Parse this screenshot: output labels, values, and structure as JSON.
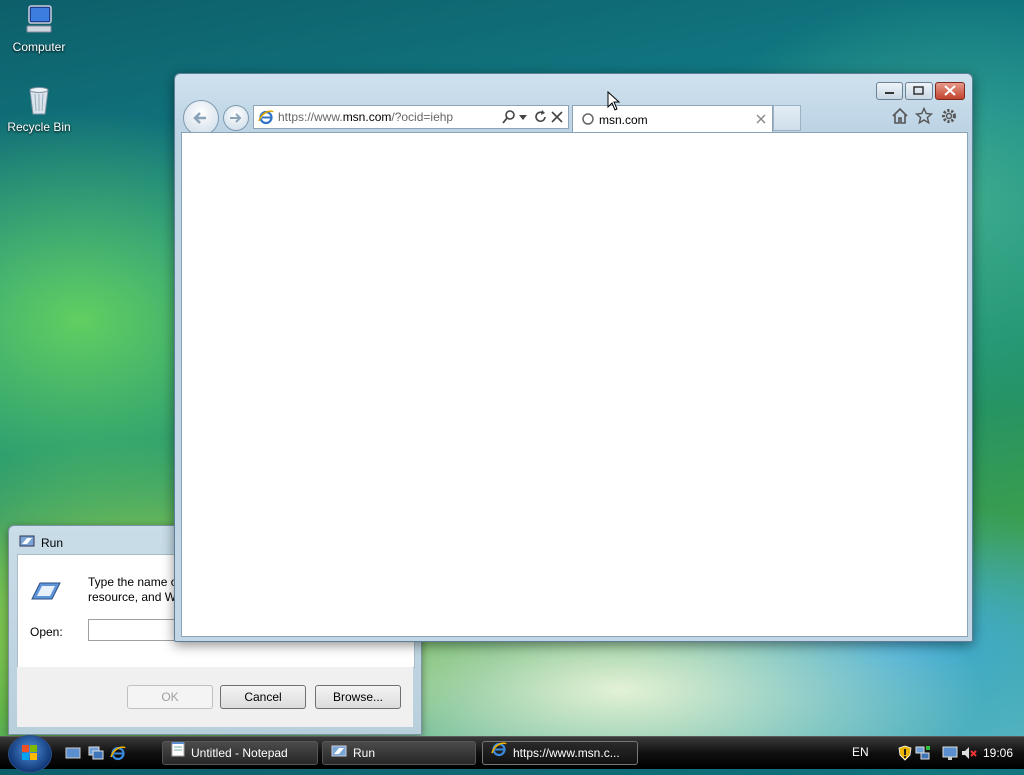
{
  "desktop": {
    "icons": [
      {
        "label": "Computer",
        "icon": "computer-icon"
      },
      {
        "label": "Recycle Bin",
        "icon": "recycle-bin-icon"
      }
    ]
  },
  "run_dialog": {
    "title": "Run",
    "description": "Type the name of\nresource, and Win",
    "open_label": "Open:",
    "open_value": "",
    "ok_label": "OK",
    "cancel_label": "Cancel",
    "browse_label": "Browse..."
  },
  "ie_window": {
    "address_url_prefix": "https://www.",
    "address_url_domain": "msn.com",
    "address_url_suffix": "/?ocid=iehp",
    "tab_title": "msn.com",
    "accent": "#1a5fb4"
  },
  "taskbar": {
    "tasks": [
      {
        "label": "Untitled - Notepad",
        "icon": "notepad-icon"
      },
      {
        "label": "Run",
        "icon": "run-icon"
      },
      {
        "label": "https://www.msn.c...",
        "icon": "ie-icon"
      }
    ],
    "language": "EN",
    "time": "19:06"
  }
}
